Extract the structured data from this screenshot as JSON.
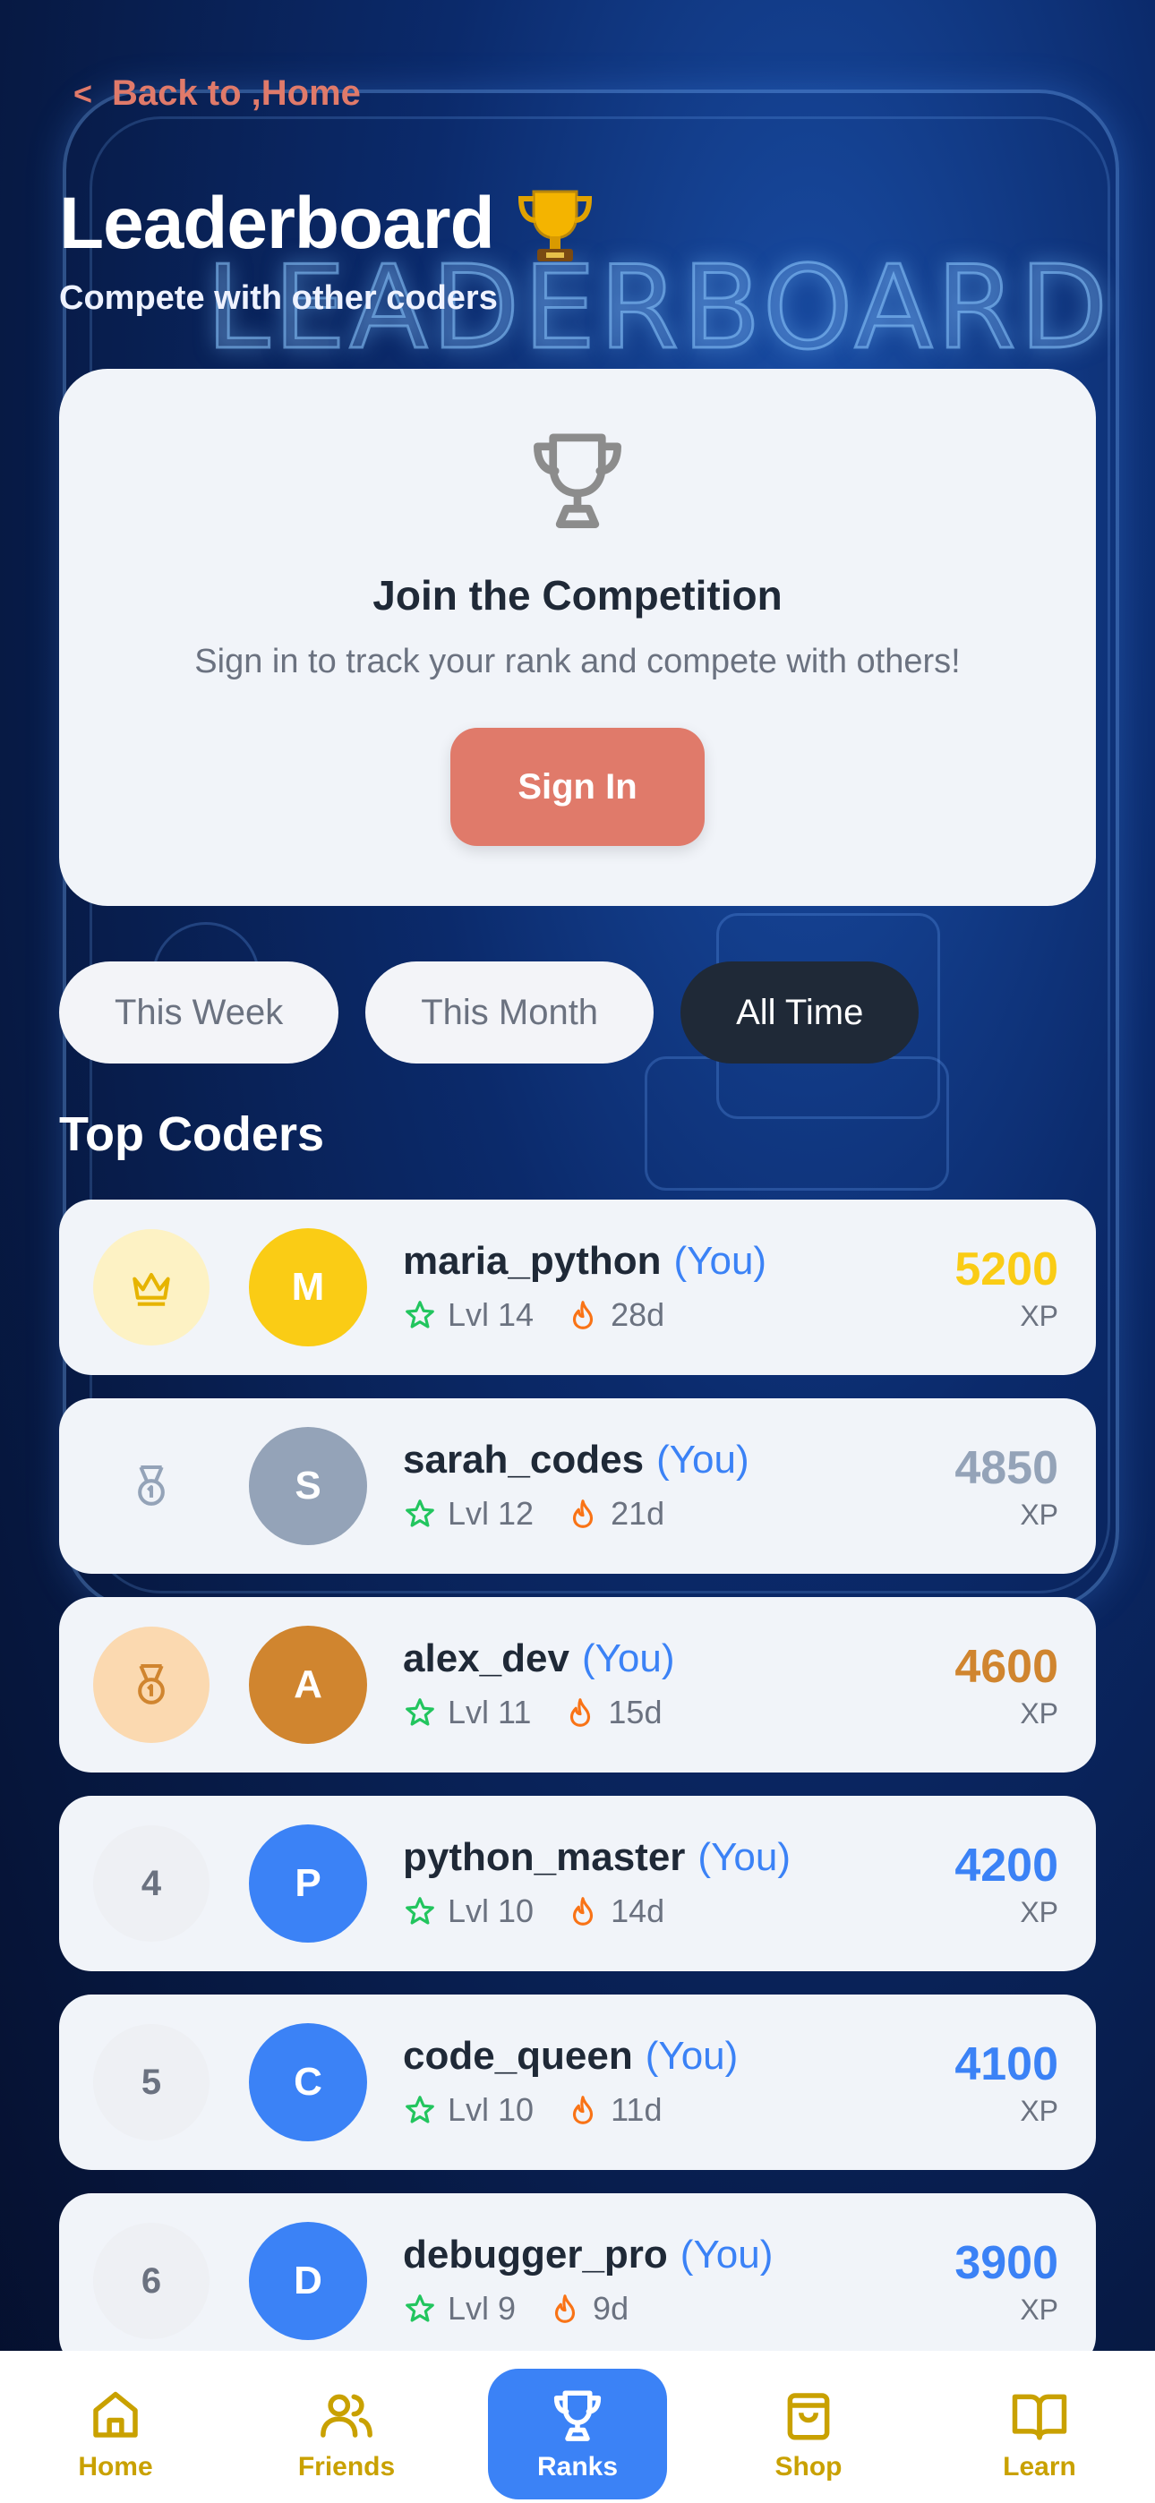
{
  "header": {
    "back_label": "Back to ,Home",
    "title": "Leaderboard",
    "subtitle": "Compete with other coders",
    "background_word": "LEADERBOARD"
  },
  "join_card": {
    "title": "Join the Competition",
    "text": "Sign in to track your rank and compete with others!",
    "sign_in_label": "Sign In"
  },
  "tabs": [
    {
      "label": "This Week",
      "active": false
    },
    {
      "label": "This Month",
      "active": false
    },
    {
      "label": "All Time",
      "active": true
    }
  ],
  "section_title": "Top Coders",
  "coders": [
    {
      "rank": "1",
      "rank_icon": "crown-icon",
      "initial": "M",
      "username": "maria_python",
      "you": "(You)",
      "level": "Lvl 14",
      "streak": "28d",
      "xp": "5200",
      "xp_unit": "XP",
      "avatar_color": "#facc15",
      "xp_color": "#facc15",
      "rank_bg": "#fdf2c4",
      "rank_fg": "#e6b400"
    },
    {
      "rank": "2",
      "rank_icon": "medal-icon",
      "initial": "S",
      "username": "sarah_codes",
      "you": "(You)",
      "level": "Lvl 12",
      "streak": "21d",
      "xp": "4850",
      "xp_unit": "XP",
      "avatar_color": "#94a3b8",
      "xp_color": "#94a3b8",
      "rank_bg": "#f1f4f9",
      "rank_fg": "#94a3b8"
    },
    {
      "rank": "3",
      "rank_icon": "medal-icon",
      "initial": "A",
      "username": "alex_dev",
      "you": "(You)",
      "level": "Lvl 11",
      "streak": "15d",
      "xp": "4600",
      "xp_unit": "XP",
      "avatar_color": "#d0852f",
      "xp_color": "#d0852f",
      "rank_bg": "#fbd9b0",
      "rank_fg": "#d0852f"
    },
    {
      "rank": "4",
      "rank_icon": "",
      "initial": "P",
      "username": "python_master",
      "you": "(You)",
      "level": "Lvl 10",
      "streak": "14d",
      "xp": "4200",
      "xp_unit": "XP",
      "avatar_color": "#3b82f6",
      "xp_color": "#3b82f6",
      "rank_bg": "#eef0f4",
      "rank_fg": "#6b7280"
    },
    {
      "rank": "5",
      "rank_icon": "",
      "initial": "C",
      "username": "code_queen",
      "you": "(You)",
      "level": "Lvl 10",
      "streak": "11d",
      "xp": "4100",
      "xp_unit": "XP",
      "avatar_color": "#3b82f6",
      "xp_color": "#3b82f6",
      "rank_bg": "#eef0f4",
      "rank_fg": "#6b7280"
    },
    {
      "rank": "6",
      "rank_icon": "",
      "initial": "D",
      "username": "debugger_pro",
      "you": "(You)",
      "level": "Lvl 9",
      "streak": "9d",
      "xp": "3900",
      "xp_unit": "XP",
      "avatar_color": "#3b82f6",
      "xp_color": "#3b82f6",
      "rank_bg": "#eef0f4",
      "rank_fg": "#6b7280"
    }
  ],
  "nav": [
    {
      "label": "Home",
      "icon": "home-icon",
      "active": false
    },
    {
      "label": "Friends",
      "icon": "friends-icon",
      "active": false
    },
    {
      "label": "Ranks",
      "icon": "trophy-icon",
      "active": true
    },
    {
      "label": "Shop",
      "icon": "shopping-bag-icon",
      "active": false
    },
    {
      "label": "Learn",
      "icon": "book-icon",
      "active": false
    }
  ],
  "colors": {
    "accent": "#e07a6a",
    "active_tab": "#1f2937",
    "nav_active": "#3b82f6",
    "nav_inactive": "#c9a100"
  }
}
